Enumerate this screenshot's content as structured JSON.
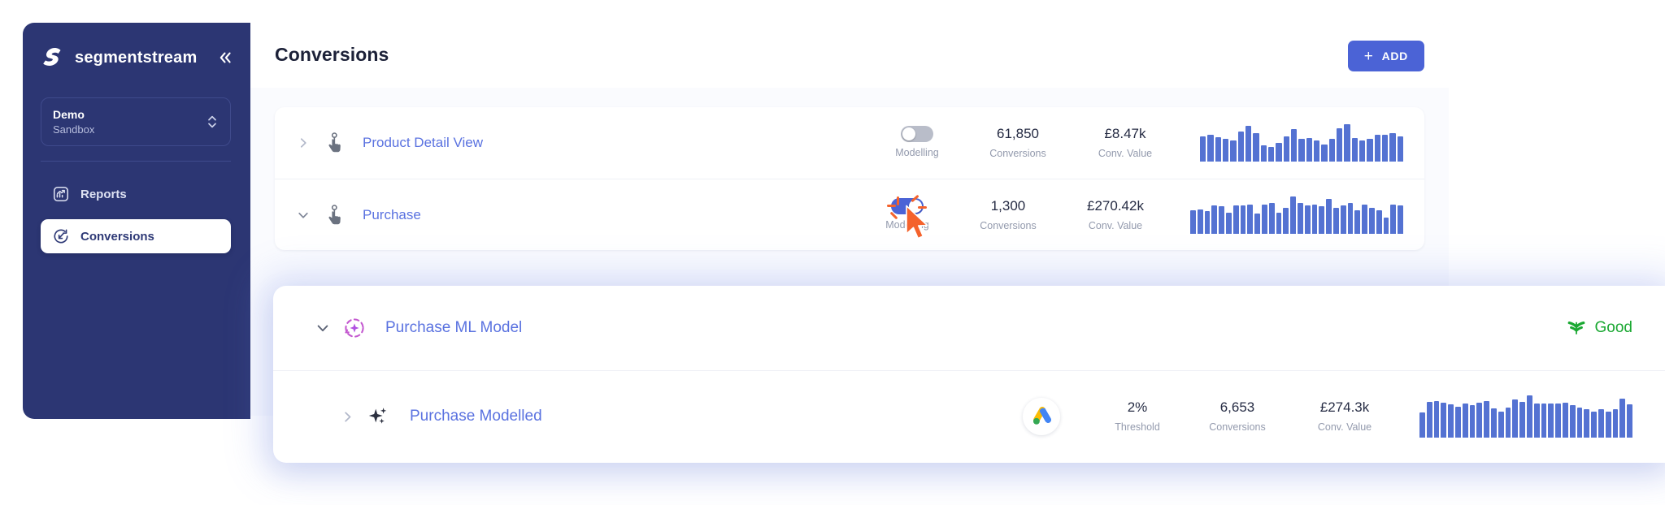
{
  "sidebar": {
    "brand_name": "segmentstream",
    "logo_icon": "segmentstream-bolt-logo",
    "collapse_icon": "double-chevron-left-icon",
    "workspace": {
      "name": "Demo",
      "environment": "Sandbox",
      "selector_icon": "chevron-up-down-icon"
    },
    "items": [
      {
        "label": "Reports",
        "icon": "chart-report-icon",
        "active": false
      },
      {
        "label": "Conversions",
        "icon": "conversion-arrow-icon",
        "active": true
      }
    ]
  },
  "header": {
    "title": "Conversions",
    "add_button": {
      "label": "ADD",
      "icon": "plus-icon"
    }
  },
  "columns": {
    "modelling": "Modelling",
    "threshold": "Threshold",
    "conversions": "Conversions",
    "conv_value": "Conv. Value"
  },
  "conversions": [
    {
      "name": "Product Detail View",
      "icon": "tap-hand-icon",
      "expander": "chevron-right-icon",
      "expanded": false,
      "modelling_on": false,
      "conversions": "61,850",
      "conv_value": "£8.47k",
      "sparkline": [
        62,
        66,
        60,
        56,
        53,
        75,
        88,
        72,
        40,
        36,
        46,
        63,
        81,
        57,
        59,
        52,
        42,
        56,
        84,
        93,
        58,
        53,
        56,
        67,
        66,
        71,
        62
      ]
    },
    {
      "name": "Purchase",
      "icon": "tap-hand-icon",
      "expander": "chevron-down-icon",
      "expanded": true,
      "modelling_on": true,
      "conversions": "1,300",
      "conv_value": "£270.42k",
      "sparkline": [
        58,
        62,
        57,
        70,
        68,
        52,
        72,
        71,
        73,
        51,
        74,
        78,
        52,
        66,
        95,
        78,
        70,
        74,
        68,
        88,
        66,
        72,
        77,
        60,
        73,
        66,
        60,
        41,
        74,
        70
      ],
      "cursor": {
        "icon": "mouse-pointer-arrow",
        "state": "clicking",
        "target": "modelling-toggle"
      }
    }
  ],
  "ml_model": {
    "name": "Purchase ML Model",
    "icon": "ml-sparkle-circle-icon",
    "expander": "chevron-down-icon",
    "status": {
      "label": "Good",
      "icon": "signal-strength-icon",
      "color": "#1aa832"
    },
    "child": {
      "name": "Purchase Modelled",
      "icon": "sparkles-icon",
      "expander": "chevron-right-icon",
      "platform_icon": "google-ads-logo",
      "threshold": "2%",
      "conversions": "6,653",
      "conv_value": "£274.3k",
      "sparkline": [
        54,
        76,
        78,
        74,
        70,
        66,
        72,
        68,
        75,
        78,
        62,
        56,
        65,
        82,
        76,
        90,
        72,
        73,
        73,
        72,
        74,
        68,
        65,
        60,
        56,
        60,
        55,
        60,
        83,
        70
      ]
    }
  },
  "colors": {
    "sidebar_bg": "#2c3673",
    "accent": "#4b63d6",
    "link": "#5a72e0",
    "bar": "#5472d2",
    "status_good": "#1aa832",
    "cursor": "#f4622c",
    "ml_icon": "#c45ad0"
  }
}
